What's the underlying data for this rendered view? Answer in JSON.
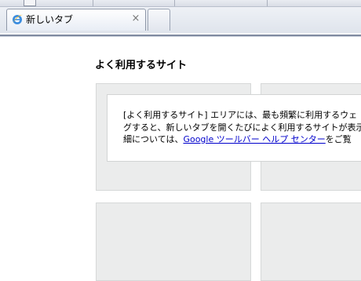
{
  "tab": {
    "title": "新しいタブ",
    "close_glyph": "×",
    "icon": "ie-icon"
  },
  "new_tab_button": {
    "icon": "new-tab-icon"
  },
  "content": {
    "heading": "よく利用するサイト",
    "info": {
      "line1": "[よく利用するサイト] エリアには、最も頻繁に利用するウェ",
      "line2": "グすると、新しいタブを開くたびによく利用するサイトが表示",
      "line3_prefix": "細については、",
      "link_text": "Google ツールバー ヘルプ センター",
      "line3_suffix": "をご覧"
    }
  },
  "colors": {
    "tile_bg": "#ebecec",
    "link": "#0000cc",
    "tab_border": "#8e97a8"
  }
}
